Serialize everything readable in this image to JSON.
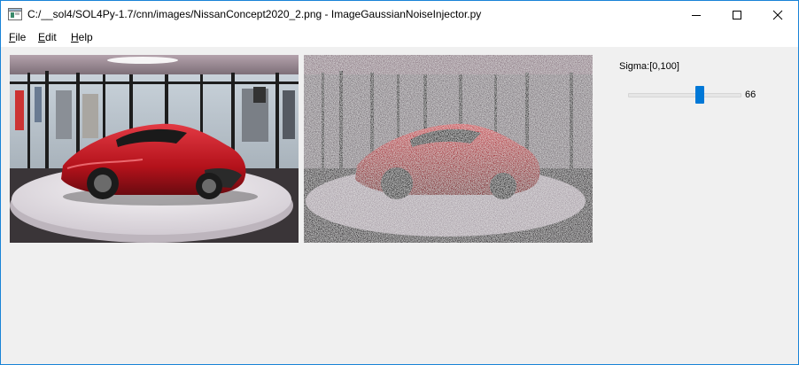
{
  "window": {
    "title": "C:/__sol4/SOL4Py-1.7/cnn/images/NissanConcept2020_2.png - ImageGaussianNoiseInjector.py",
    "controls": {
      "minimize_icon": "minimize-icon",
      "maximize_icon": "maximize-icon",
      "close_icon": "close-icon"
    }
  },
  "menu": {
    "file": {
      "mnemonic": "F",
      "rest": "ile"
    },
    "edit": {
      "mnemonic": "E",
      "rest": "dit"
    },
    "help": {
      "mnemonic": "H",
      "rest": "elp"
    }
  },
  "images": {
    "original": {
      "subject": "red Nissan concept car on white turntable in showroom"
    },
    "noisy": {
      "subject": "same car image with gaussian noise applied"
    }
  },
  "sigma": {
    "label": "Sigma:[0,100]",
    "min": 0,
    "max": 100,
    "value": "66"
  },
  "colors": {
    "accent": "#0078d7",
    "window_border": "#1883d7",
    "car_red": "#c8141e"
  }
}
